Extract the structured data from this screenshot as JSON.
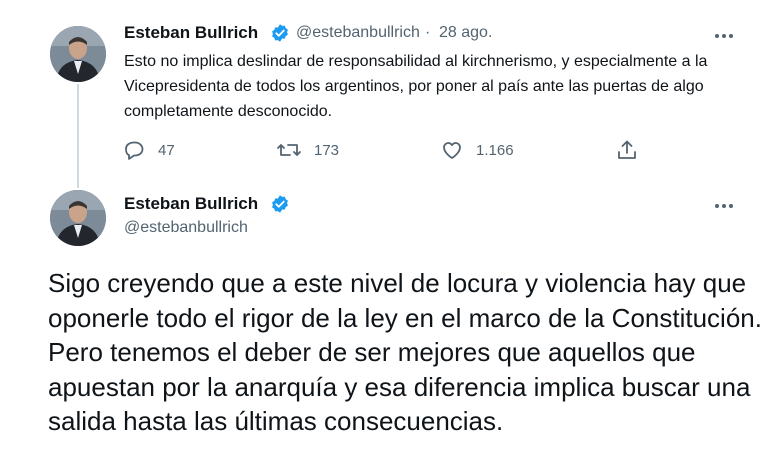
{
  "tweet1": {
    "author": "Esteban Bullrich",
    "handle": "@estebanbullrich",
    "separator": "·",
    "date": "28 ago.",
    "text": "Esto no implica deslindar de responsabilidad al kirchnerismo, y especialmente a la Vicepresidenta de todos los argentinos, por poner al país ante las puertas de algo completamente desconocido.",
    "replies": "47",
    "retweets": "173",
    "likes": "1.166"
  },
  "tweet2": {
    "author": "Esteban Bullrich",
    "handle": "@estebanbullrich",
    "text": "Sigo creyendo que a este nivel de locura y violencia hay que oponerle todo el rigor de la ley en el marco de la Constitución. Pero tenemos el deber de ser mejores que aquellos que apuestan por la anarquía y esa diferencia implica buscar una salida hasta las últimas consecuencias."
  },
  "icons": {
    "verified": "verified-badge-icon",
    "more": "more-options-icon",
    "reply": "reply-icon",
    "retweet": "retweet-icon",
    "like": "heart-icon",
    "share": "share-icon"
  },
  "colors": {
    "verified": "#1d9bf0",
    "secondary_text": "#536471",
    "primary_text": "#0f1419",
    "thread_line": "#cfd9de"
  }
}
